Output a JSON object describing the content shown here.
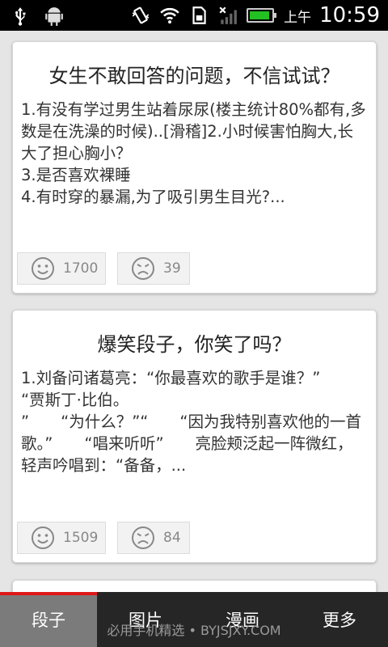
{
  "status_bar": {
    "ampm": "上午",
    "time": "10:59",
    "battery_color": "#22c022"
  },
  "posts": [
    {
      "title": "女生不敢回答的问题，不信试试？",
      "body": "1.有没有学过男生站着尿尿(楼主统计80%都有,多数是在洗澡的时候)..[滑稽]2.小时候害怕胸大,长大了担心胸小？\n3.是否喜欢裸睡\n4.有时穿的暴漏,为了吸引男生目光?...",
      "likes": "1700",
      "dislikes": "39"
    },
    {
      "title": "爆笑段子，你笑了吗？",
      "body": "1.刘备问诸葛亮：“你最喜欢的歌手是谁？”　　“贾斯丁·比伯。\n”　　“为什么？”“　　“因为我特别喜欢他的一首歌。”　　“唱来听听”　　亮脸颊泛起一阵微红，轻声吟唱到：“备备，...",
      "likes": "1509",
      "dislikes": "84"
    }
  ],
  "nav": {
    "tabs": [
      "段子",
      "图片",
      "漫画",
      "更多"
    ],
    "active_index": 0
  },
  "watermark": "必用手机精选 • BYJSJXY.COM",
  "colors": {
    "accent": "#e01818",
    "nav_background": "#262626",
    "active_tab": "#7b7b7b"
  }
}
